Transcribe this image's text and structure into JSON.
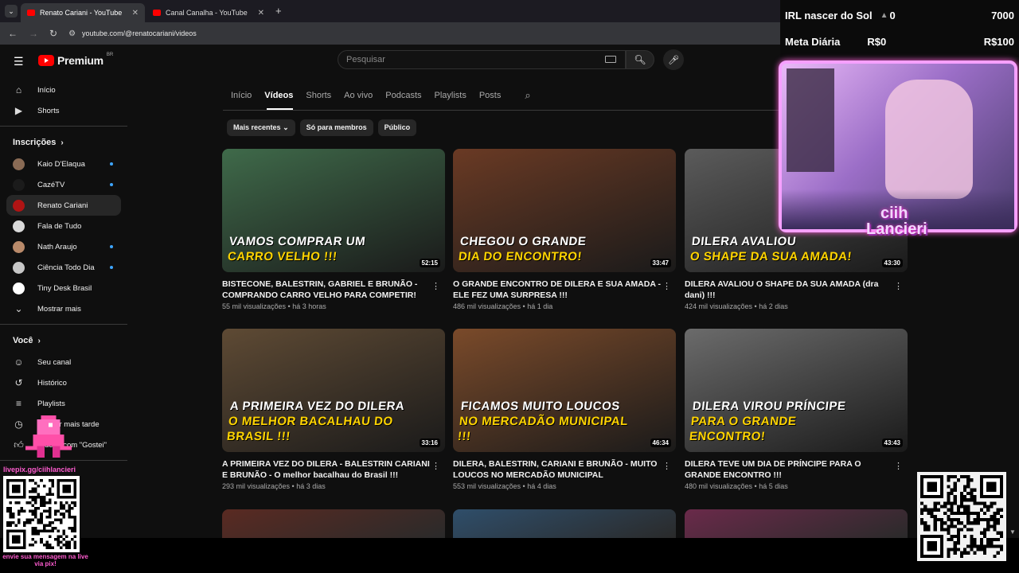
{
  "browser": {
    "tabs": [
      {
        "title": "Renato Cariani - YouTube",
        "active": true
      },
      {
        "title": "Canal Canalha - YouTube",
        "active": false
      }
    ],
    "new_tab": "+",
    "url": "youtube.com/@renatocariani/videos"
  },
  "header": {
    "logo_text": "Premium",
    "logo_region": "BR",
    "search_placeholder": "Pesquisar"
  },
  "sidebar": {
    "home": "Início",
    "shorts": "Shorts",
    "subscriptions_title": "Inscrições",
    "subscriptions": [
      {
        "name": "Kaio D'Elaqua",
        "new": true,
        "color": "#8a6b55"
      },
      {
        "name": "CazéTV",
        "new": true,
        "color": "#1b1b1b"
      },
      {
        "name": "Renato Cariani",
        "new": false,
        "color": "#b01414"
      },
      {
        "name": "Fala de Tudo",
        "new": false,
        "color": "#d9d9d9"
      },
      {
        "name": "Nath Araujo",
        "new": true,
        "color": "#b98a6a"
      },
      {
        "name": "Ciência Todo Dia",
        "new": true,
        "color": "#c7c7c7"
      },
      {
        "name": "Tiny Desk Brasil",
        "new": false,
        "color": "#ffffff"
      }
    ],
    "show_more": "Mostrar mais",
    "you_title": "Você",
    "you_items": [
      "Seu canal",
      "Histórico",
      "Playlists",
      "Assistir mais tarde",
      "Vídeos com \"Gostei\""
    ]
  },
  "channel_tabs": [
    "Início",
    "Vídeos",
    "Shorts",
    "Ao vivo",
    "Podcasts",
    "Playlists",
    "Posts"
  ],
  "filters": [
    "Mais recentes",
    "Só para membros",
    "Público"
  ],
  "videos": [
    {
      "title": "BISTECONE, BALESTRIN, GABRIEL E BRUNÃO - COMPRANDO CARRO VELHO PARA COMPETIR!",
      "views": "55 mil visualizações",
      "age": "há 3 horas",
      "duration": "52:15",
      "cap1": "VAMOS COMPRAR UM",
      "cap2": "CARRO VELHO !!!",
      "bg": "#3f6a4a"
    },
    {
      "title": "O GRANDE ENCONTRO DE DILERA E SUA AMADA - ELE FEZ UMA SURPRESA !!!",
      "views": "486 mil visualizações",
      "age": "há 1 dia",
      "duration": "33:47",
      "cap1": "CHEGOU O GRANDE",
      "cap2": "DIA DO ENCONTRO!",
      "bg": "#6a3a24"
    },
    {
      "title": "DILERA AVALIOU  O SHAPE DA SUA AMADA (dra dani) !!!",
      "views": "424 mil visualizações",
      "age": "há 2 dias",
      "duration": "43:30",
      "cap1": "DILERA AVALIOU",
      "cap2": "O SHAPE DA SUA AMADA!",
      "bg": "#5b5b5b"
    },
    {
      "title": "A PRIMEIRA VEZ DO DILERA - BALESTRIN CARIANI E BRUNÃO - O melhor bacalhau do Brasil !!!",
      "views": "293 mil visualizações",
      "age": "há 3 dias",
      "duration": "33:16",
      "cap1": "A PRIMEIRA VEZ DO DILERA",
      "cap2": "O MELHOR BACALHAU DO BRASIL !!!",
      "bg": "#5e4a34"
    },
    {
      "title": "DILERA, BALESTRIN, CARIANI E BRUNÃO - MUITO LOUCOS NO MERCADÃO MUNICIPAL",
      "views": "553 mil visualizações",
      "age": "há 4 dias",
      "duration": "46:34",
      "cap1": "FICAMOS MUITO LOUCOS",
      "cap2": "NO MERCADÃO MUNICIPAL !!!",
      "bg": "#7a4a2a"
    },
    {
      "title": "DILERA TEVE UM DIA DE PRÍNCIPE PARA O GRANDE ENCONTRO !!!",
      "views": "480 mil visualizações",
      "age": "há 5 dias",
      "duration": "43:43",
      "cap1": "DILERA VIROU PRÍNCIPE",
      "cap2": "PARA O GRANDE ENCONTRO!",
      "bg": "#6b6b6b"
    }
  ],
  "next_row_bgs": [
    "#5a2a22",
    "#2f4e6a",
    "#6a2a4a"
  ],
  "overlay": {
    "row1_label": "IRL nascer do Sol",
    "row1_value": "0",
    "row1_goal": "7000",
    "row2_label": "Meta Diária",
    "row2_value": "R$0",
    "row2_goal": "R$100",
    "cam_name_1": "ciih",
    "cam_name_2": "Lancieri",
    "livepix": "livepix.gg/ciihlancieri",
    "envie": "envie sua mensagem na live via pix!"
  }
}
